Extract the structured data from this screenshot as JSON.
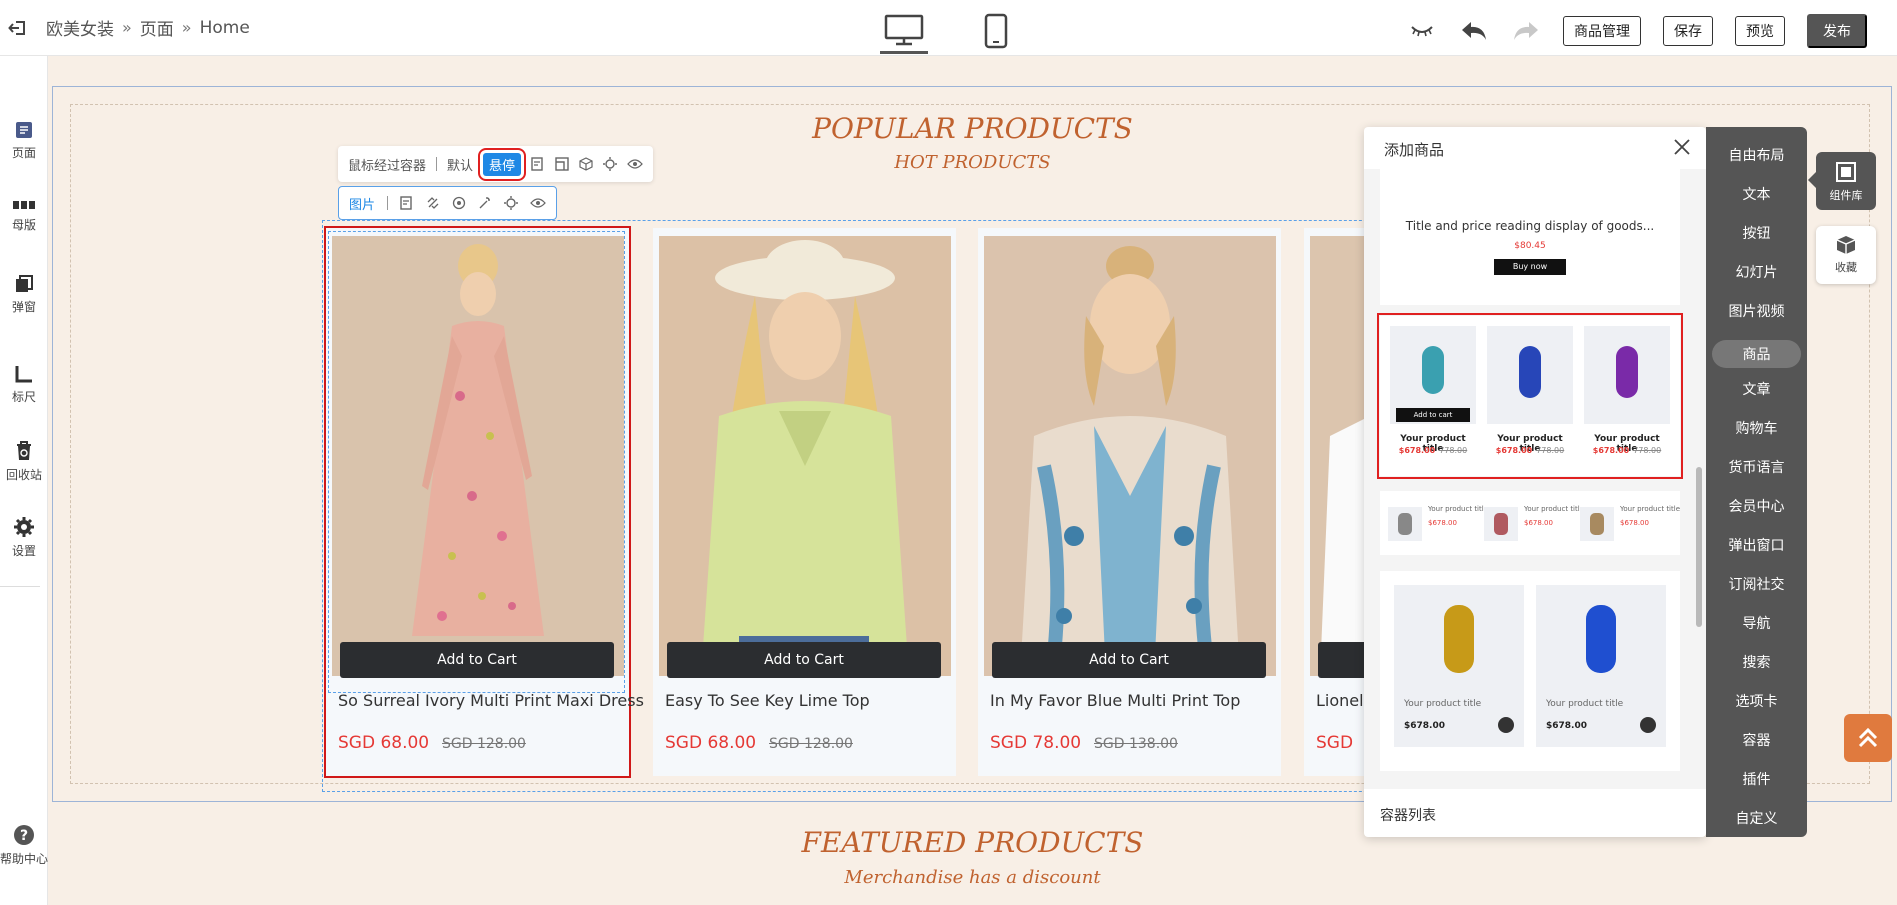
{
  "topbar": {
    "breadcrumb": [
      "欧美女装",
      "页面",
      "Home"
    ],
    "buttons": {
      "products": "商品管理",
      "save": "保存",
      "preview": "预览",
      "publish": "发布"
    }
  },
  "sidebar": {
    "items": [
      {
        "label": "页面",
        "icon": "page-icon"
      },
      {
        "label": "母版",
        "icon": "master-icon"
      },
      {
        "label": "弹窗",
        "icon": "popup-icon"
      },
      {
        "label": "标尺",
        "icon": "ruler-icon"
      },
      {
        "label": "回收站",
        "icon": "recycle-icon"
      },
      {
        "label": "设置",
        "icon": "settings-icon"
      }
    ],
    "help": "帮助中心"
  },
  "canvas": {
    "heading1": "POPULAR PRODUCTS",
    "subheading1": "HOT PRODUCTS",
    "heading2": "FEATURED PRODUCTS",
    "subheading2": "Merchandise has a discount",
    "toolbar_container": {
      "label": "鼠标经过容器",
      "default": "默认",
      "hover": "悬停"
    },
    "toolbar_image": {
      "label": "图片"
    },
    "products": [
      {
        "title": "So Surreal Ivory Multi Print Maxi Dress",
        "price": "SGD 68.00",
        "old_price": "SGD 128.00",
        "cart": "Add to Cart"
      },
      {
        "title": "Easy To See Key Lime Top",
        "price": "SGD 68.00",
        "old_price": "SGD 128.00",
        "cart": "Add to Cart"
      },
      {
        "title": "In My Favor Blue Multi Print Top",
        "price": "SGD 78.00",
        "old_price": "SGD 138.00",
        "cart": "Add to Cart"
      },
      {
        "title": "Lionel",
        "price": "SGD",
        "old_price": "",
        "cart": ""
      }
    ]
  },
  "panel": {
    "title": "添加商品",
    "footer": "容器列表",
    "tpl1": {
      "title": "Title and price reading display of goods...",
      "price": "$80.45",
      "button": "Buy now"
    },
    "tpl2": {
      "atc": "Add to cart",
      "items": [
        {
          "title": "Your product title",
          "price": "$678.00",
          "old": "778.00",
          "color": "#3aa0b0"
        },
        {
          "title": "Your product title",
          "price": "$678.00",
          "old": "778.00",
          "color": "#2746b8"
        },
        {
          "title": "Your product title",
          "price": "$678.00",
          "old": "778.00",
          "color": "#7a2aa8"
        }
      ]
    },
    "tpl3": {
      "items": [
        {
          "title": "Your product title",
          "price": "$678.00",
          "color": "#888888"
        },
        {
          "title": "Your product title",
          "price": "$678.00",
          "color": "#b05a60"
        },
        {
          "title": "Your product title",
          "price": "$678.00",
          "color": "#a88a60"
        }
      ]
    },
    "tpl4": {
      "items": [
        {
          "title": "Your product title",
          "price": "$678.00",
          "color": "#c79a18"
        },
        {
          "title": "Your product title",
          "price": "$678.00",
          "color": "#1f4fd0"
        }
      ]
    }
  },
  "components": {
    "items": [
      "自由布局",
      "文本",
      "按钮",
      "幻灯片",
      "图片视频",
      "商品",
      "文章",
      "购物车",
      "货币语言",
      "会员中心",
      "弹出窗口",
      "订阅社交",
      "导航",
      "搜索",
      "选项卡",
      "容器",
      "插件",
      "自定义"
    ],
    "active": "商品",
    "library": "组件库",
    "favorites": "收藏"
  }
}
